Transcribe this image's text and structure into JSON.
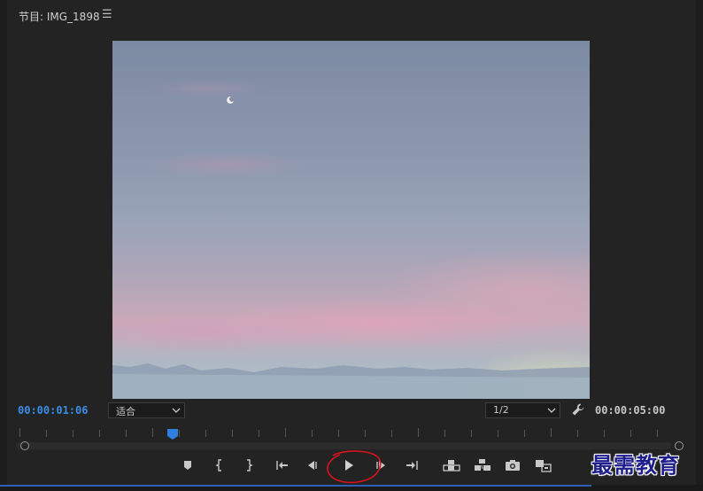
{
  "panel": {
    "title": "节目: IMG_1898",
    "menu_icon": "hamburger-menu-icon"
  },
  "monitor": {
    "current_timecode": "00:00:01:06",
    "total_duration": "00:00:05:00",
    "zoom_level": "适合",
    "resolution": "1/2",
    "playhead_position_fraction": 0.24,
    "accent_color": "#3b8ee6"
  },
  "controls": [
    {
      "name": "add-marker-icon"
    },
    {
      "name": "mark-in-icon"
    },
    {
      "name": "mark-out-icon"
    },
    {
      "name": "go-to-in-icon"
    },
    {
      "name": "step-back-icon"
    },
    {
      "name": "play-icon"
    },
    {
      "name": "step-forward-icon"
    },
    {
      "name": "go-to-out-icon"
    },
    {
      "name": "lift-icon"
    },
    {
      "name": "extract-icon"
    },
    {
      "name": "export-frame-icon"
    },
    {
      "name": "comparison-view-icon"
    }
  ],
  "watermark": {
    "text": "最需教育"
  }
}
